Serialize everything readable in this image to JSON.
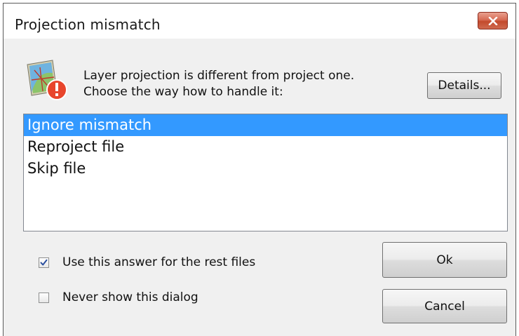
{
  "dialog": {
    "title": "Projection mismatch"
  },
  "message": {
    "line1": "Layer projection is different from project one.",
    "line2": "Choose the way how to handle it:"
  },
  "buttons": {
    "details": "Details...",
    "ok": "Ok",
    "cancel": "Cancel"
  },
  "options": {
    "items": [
      {
        "label": "Ignore mismatch",
        "selected": true
      },
      {
        "label": "Reproject file",
        "selected": false
      },
      {
        "label": "Skip file",
        "selected": false
      }
    ]
  },
  "checkboxes": {
    "use_answer": {
      "label": "Use this answer for the rest files",
      "checked": true
    },
    "never_show": {
      "label": "Never show this dialog",
      "checked": false
    }
  },
  "colors": {
    "selection": "#3399ff",
    "close_button": "#c94f33",
    "check_mark": "#2b4f9e"
  },
  "icons": {
    "close": "close-icon",
    "layer": "layer-warning-icon"
  }
}
